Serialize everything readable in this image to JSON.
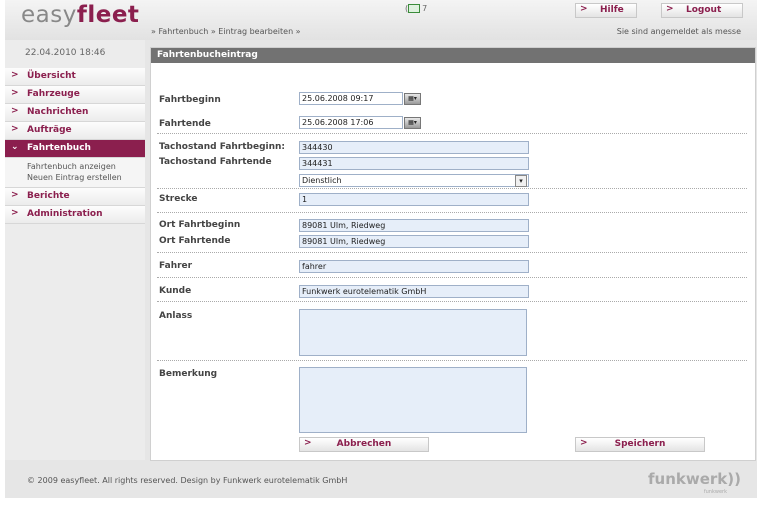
{
  "header": {
    "logo_light": "easy",
    "logo_bold": "fleet",
    "messages_count": "7",
    "help_label": "Hilfe",
    "logout_label": "Logout",
    "breadcrumb": "» Fahrtenbuch » Eintrag bearbeiten »",
    "login_status": "Sie sind angemeldet als messe"
  },
  "sidebar": {
    "date": "22.04.2010 18:46",
    "items": [
      {
        "label": "Übersicht"
      },
      {
        "label": "Fahrzeuge"
      },
      {
        "label": "Nachrichten"
      },
      {
        "label": "Aufträge"
      },
      {
        "label": "Fahrtenbuch",
        "active": true,
        "subitems": [
          "Fahrtenbuch anzeigen",
          "Neuen Eintrag erstellen"
        ]
      },
      {
        "label": "Berichte"
      },
      {
        "label": "Administration"
      }
    ]
  },
  "form": {
    "title": "Fahrtenbucheintrag",
    "fahrtbeginn_label": "Fahrtbeginn",
    "fahrtbeginn_value": "25.06.2008 09:17",
    "fahrtende_label": "Fahrtende",
    "fahrtende_value": "25.06.2008 17:06",
    "tacho_beginn_label": "Tachostand Fahrtbeginn:",
    "tacho_beginn_value": "344430",
    "tacho_ende_label": "Tachostand Fahrtende",
    "tacho_ende_value": "344431",
    "fahrtart_value": "Dienstlich",
    "strecke_label": "Strecke",
    "strecke_value": "1",
    "ort_beginn_label": "Ort Fahrtbeginn",
    "ort_beginn_value": "89081 Ulm, Riedweg",
    "ort_ende_label": "Ort Fahrtende",
    "ort_ende_value": "89081 Ulm, Riedweg",
    "fahrer_label": "Fahrer",
    "fahrer_value": "fahrer",
    "kunde_label": "Kunde",
    "kunde_value": "Funkwerk eurotelematik GmbH",
    "anlass_label": "Anlass",
    "anlass_value": "",
    "bemerkung_label": "Bemerkung",
    "bemerkung_value": "",
    "cancel_label": "Abbrechen",
    "save_label": "Speichern"
  },
  "footer": {
    "copyright": "© 2009 easyfleet. All rights reserved. Design by Funkwerk eurotelematik GmbH",
    "brand": "funkwerk",
    "brand_sub": "funkwerk"
  },
  "colors": {
    "accent": "#8b1f4e",
    "section_header": "#727272",
    "input_bg": "#e6eef9"
  }
}
